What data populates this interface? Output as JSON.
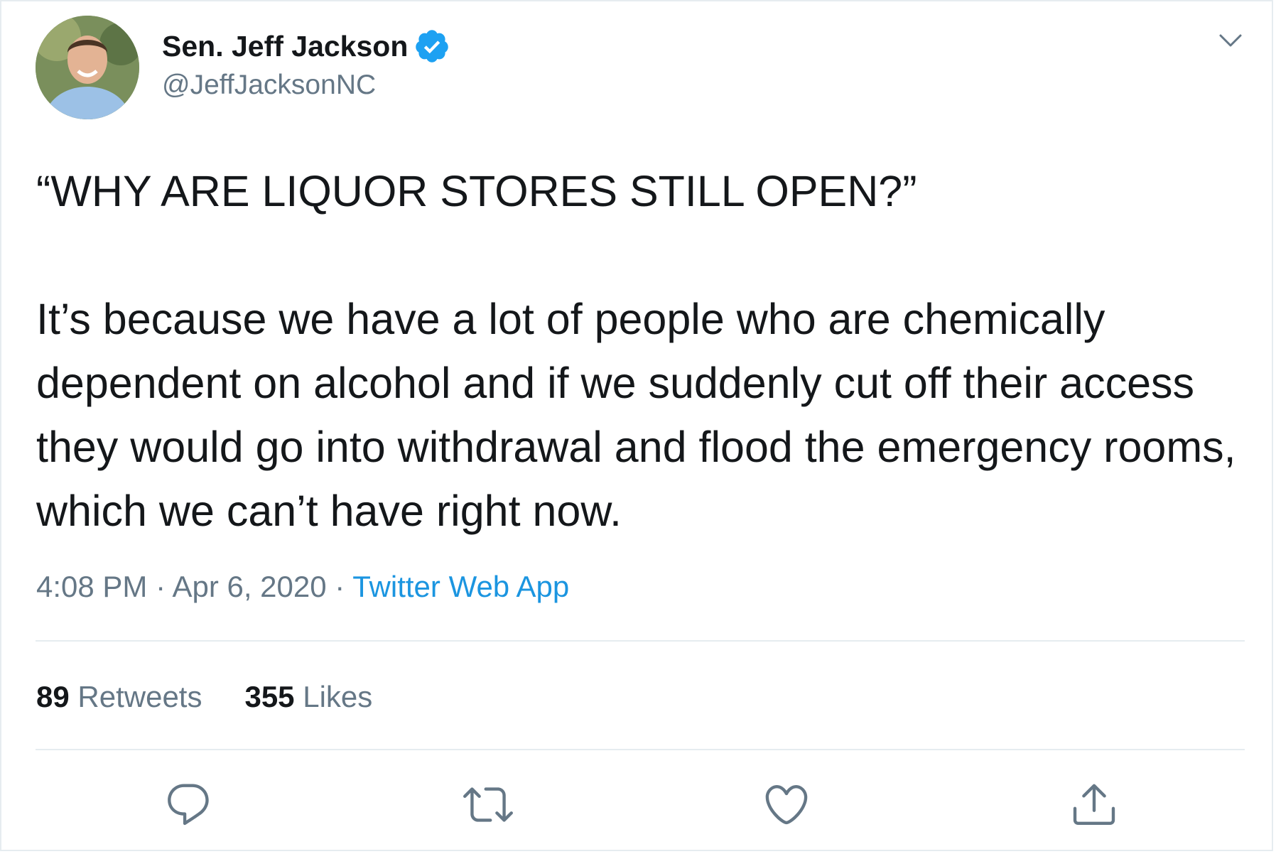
{
  "author": {
    "display_name": "Sen. Jeff Jackson",
    "handle": "@JeffJacksonNC",
    "verified": true,
    "avatar_icon": "profile-photo"
  },
  "tweet": {
    "headline": "“WHY ARE LIQUOR STORES STILL OPEN?”",
    "body": "It’s because we have a lot of people who are chemically dependent on alcohol and if we suddenly cut off their access they would go into withdrawal and flood the emergency rooms, which we can’t have right now."
  },
  "meta": {
    "time": "4:08 PM",
    "separator": "·",
    "date": "Apr 6, 2020",
    "source": "Twitter Web App"
  },
  "stats": {
    "retweets_count": "89",
    "retweets_label": "Retweets",
    "likes_count": "355",
    "likes_label": "Likes"
  },
  "actions": {
    "reply_icon": "reply-icon",
    "retweet_icon": "retweet-icon",
    "like_icon": "heart-icon",
    "share_icon": "share-icon"
  },
  "colors": {
    "text": "#14171a",
    "secondary": "#657786",
    "link": "#1b95e0",
    "verified": "#1da1f2",
    "divider": "#e6ecf0"
  }
}
